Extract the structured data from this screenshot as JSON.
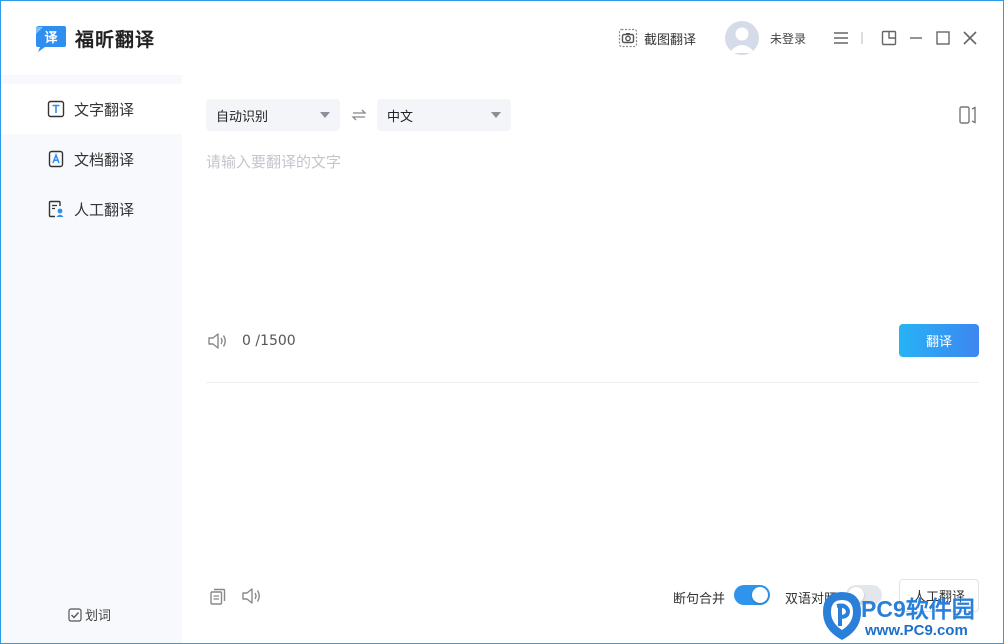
{
  "app": {
    "title": "福昕翻译",
    "logo_char": "译"
  },
  "header": {
    "screenshot_label": "截图翻译",
    "login_label": "未登录"
  },
  "sidebar": {
    "items": [
      {
        "label": "文字翻译",
        "active": true
      },
      {
        "label": "文档翻译",
        "active": false
      },
      {
        "label": "人工翻译",
        "active": false
      }
    ],
    "word_pick_label": "划词"
  },
  "main": {
    "source_lang": "自动识别",
    "target_lang": "中文",
    "input_placeholder": "请输入要翻译的文字",
    "input_value": "",
    "counter": "0 /1500",
    "translate_label": "翻译",
    "merge_label": "断句合并",
    "merge_on": true,
    "bilingual_label": "双语对照",
    "bilingual_on": false,
    "human_translate_label": "人工翻译"
  },
  "colors": {
    "accent": "#2e9be8",
    "toggle_on": "#2f95ec",
    "toggle_off": "#e3e6ea"
  },
  "watermark": {
    "text": "PC9软件园",
    "url": "www.PC9.com"
  }
}
